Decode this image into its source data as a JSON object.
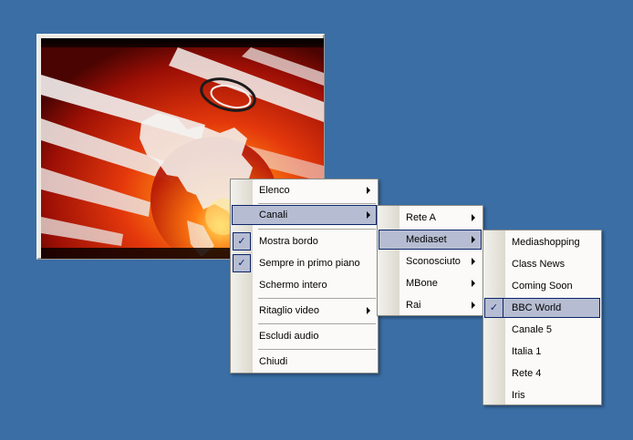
{
  "colors": {
    "desktop": "#3a6ea5",
    "menu_background": "#fbfaf8",
    "highlight": "#b6bdd2",
    "highlight_border": "#0a246a"
  },
  "video_window": {
    "content": "news-globe-animation"
  },
  "context_menu": {
    "items": [
      {
        "label": "Elenco",
        "submenu": true
      },
      {
        "label": "Canali",
        "submenu": true,
        "highlighted": true
      },
      {
        "label": "Mostra bordo",
        "checked": true
      },
      {
        "label": "Sempre in primo piano",
        "checked": true
      },
      {
        "label": "Schermo intero"
      },
      {
        "label": "Ritaglio video",
        "submenu": true
      },
      {
        "label": "Escludi audio"
      },
      {
        "label": "Chiudi"
      }
    ]
  },
  "canali_submenu": {
    "items": [
      {
        "label": "Rete A",
        "submenu": true
      },
      {
        "label": "Mediaset",
        "submenu": true,
        "highlighted": true
      },
      {
        "label": "Sconosciuto",
        "submenu": true
      },
      {
        "label": "MBone",
        "submenu": true
      },
      {
        "label": "Rai",
        "submenu": true
      }
    ]
  },
  "mediaset_submenu": {
    "items": [
      {
        "label": "Mediashopping"
      },
      {
        "label": "Class News"
      },
      {
        "label": "Coming Soon"
      },
      {
        "label": "BBC World",
        "checked": true,
        "highlighted": true
      },
      {
        "label": "Canale 5"
      },
      {
        "label": "Italia 1"
      },
      {
        "label": "Rete 4"
      },
      {
        "label": "Iris"
      }
    ]
  }
}
